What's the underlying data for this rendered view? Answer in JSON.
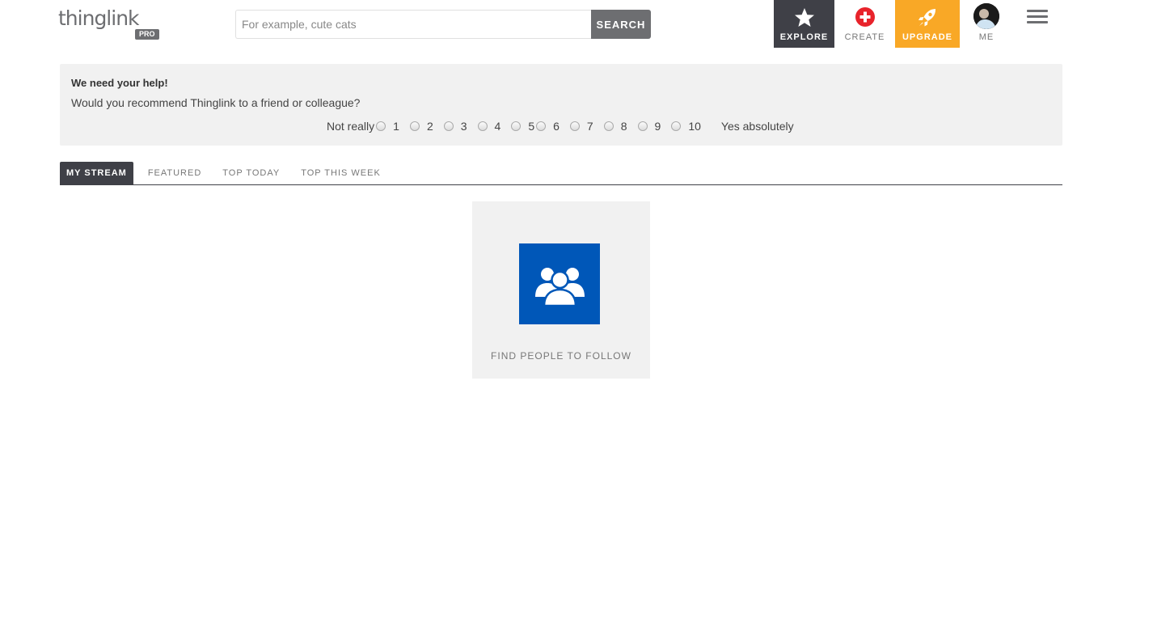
{
  "header": {
    "logo_text": "thinglink",
    "logo_badge": "PRO",
    "search": {
      "placeholder": "For example, cute cats",
      "value": "",
      "button_label": "SEARCH"
    },
    "nav": {
      "explore": "EXPLORE",
      "create": "CREATE",
      "upgrade": "UPGRADE",
      "me": "ME"
    }
  },
  "survey": {
    "title": "We need your help!",
    "question": "Would you recommend Thinglink to a friend or colleague?",
    "label_low": "Not really",
    "label_high": "Yes absolutely",
    "options": [
      "1",
      "2",
      "3",
      "4",
      "5",
      "6",
      "7",
      "8",
      "9",
      "10"
    ]
  },
  "tabs": {
    "my_stream": "MY STREAM",
    "featured": "FEATURED",
    "top_today": "TOP TODAY",
    "top_this_week": "TOP THIS WEEK",
    "active": "MY STREAM"
  },
  "card": {
    "label": "FIND PEOPLE TO FOLLOW",
    "icon": "people-icon"
  },
  "colors": {
    "explore_bg": "#3f4047",
    "upgrade_bg": "#f9a826",
    "create_icon": "#e8232b",
    "card_icon_bg": "#0057b8",
    "search_button_bg": "#6d6e71"
  }
}
